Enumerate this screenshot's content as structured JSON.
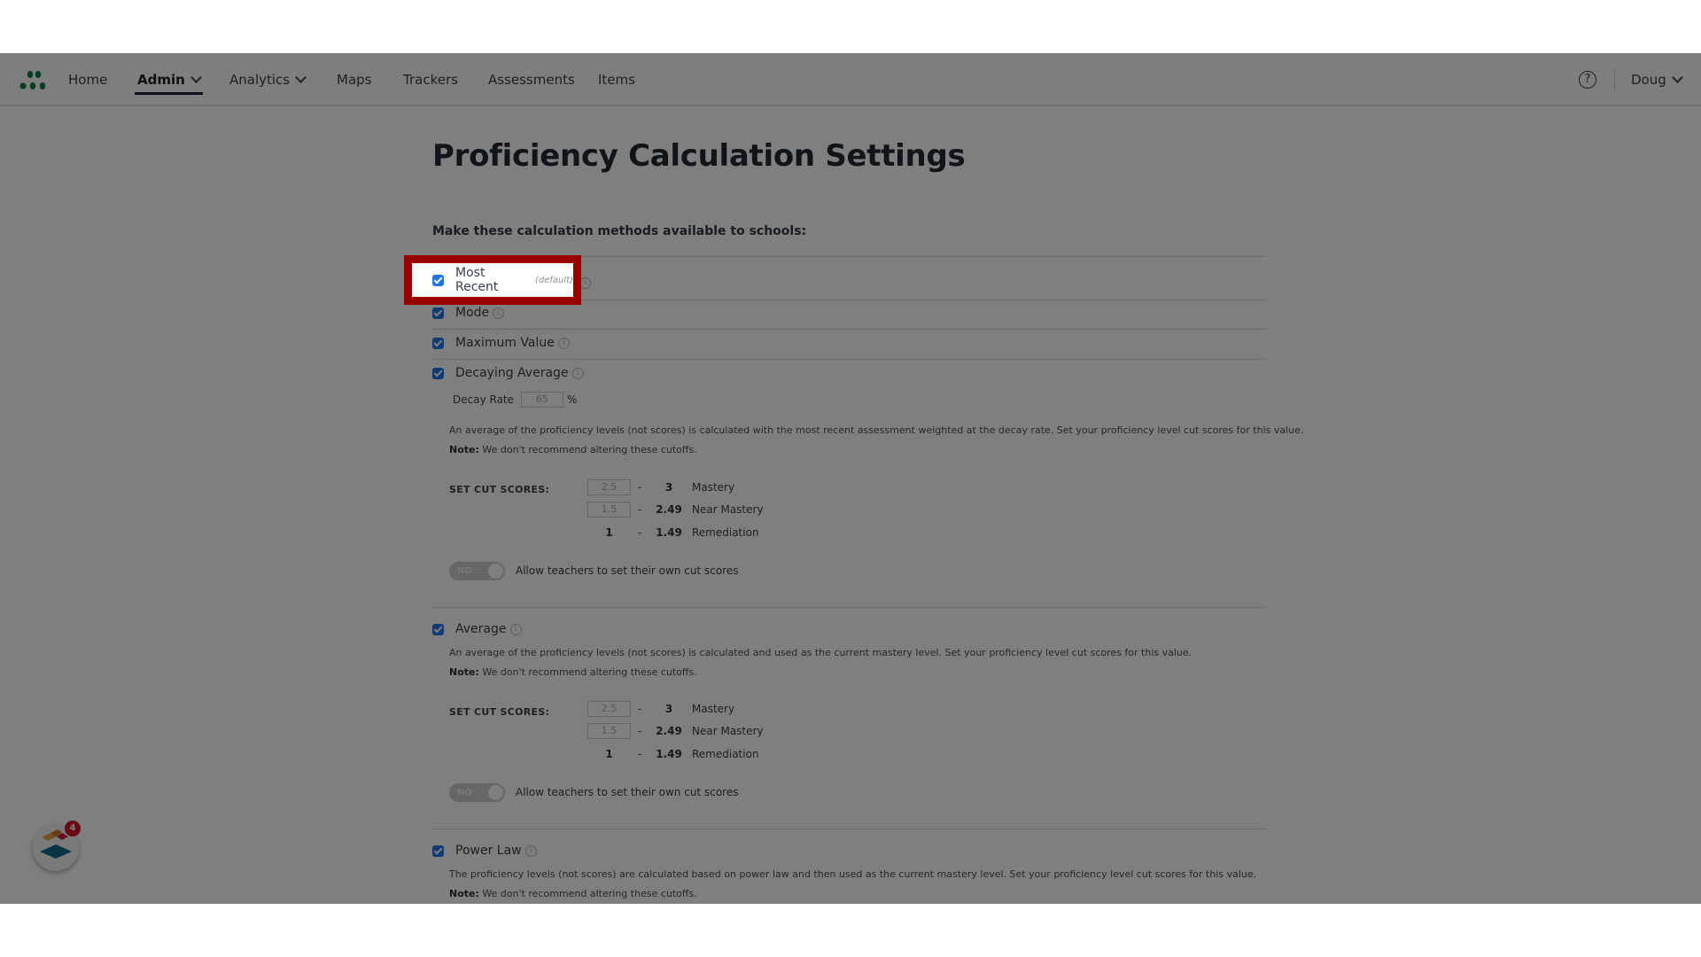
{
  "nav": {
    "logo": "app-logo",
    "items": [
      {
        "label": "Home",
        "active": false,
        "dropdown": false
      },
      {
        "label": "Admin",
        "active": true,
        "dropdown": true
      },
      {
        "label": "Analytics",
        "active": false,
        "dropdown": true
      },
      {
        "label": "Maps",
        "active": false,
        "dropdown": false
      },
      {
        "label": "Trackers",
        "active": false,
        "dropdown": false
      },
      {
        "label": "Assessments",
        "active": false,
        "dropdown": false
      },
      {
        "label": "Items",
        "active": false,
        "dropdown": false
      }
    ],
    "help_icon": "?",
    "user": "Doug"
  },
  "page": {
    "title": "Proficiency Calculation Settings",
    "subheading": "Make these calculation methods available to schools:"
  },
  "methods": [
    {
      "label": "Most Recent",
      "checked": true,
      "tag": "(default)",
      "highlighted": true
    },
    {
      "label": "Mode",
      "checked": true
    },
    {
      "label": "Maximum Value",
      "checked": true
    },
    {
      "label": "Decaying Average",
      "checked": true
    },
    {
      "label": "Average",
      "checked": true
    },
    {
      "label": "Power Law",
      "checked": true
    }
  ],
  "decaying_average": {
    "decay_rate_label": "Decay Rate",
    "decay_rate_value": "65",
    "decay_rate_unit": "%",
    "description": "An average of the proficiency levels (not scores) is calculated with the most recent assessment weighted at the decay rate. Set your proficiency level cut scores for this value.",
    "note_label": "Note:",
    "note_text": " We don't recommend altering these cutoffs.",
    "cut_scores_label": "SET CUT SCORES:",
    "cut_scores": [
      {
        "low": "2.5",
        "high": "3",
        "level": "Mastery",
        "editable": true
      },
      {
        "low": "1.5",
        "high": "2.49",
        "level": "Near Mastery",
        "editable": true
      },
      {
        "low": "1",
        "high": "1.49",
        "level": "Remediation",
        "editable": false
      }
    ],
    "toggle_state": "NO",
    "toggle_label": "Allow teachers to set their own cut scores"
  },
  "average": {
    "description": "An average of the proficiency levels (not scores) is calculated and used as the current mastery level. Set your proficiency level cut scores for this value.",
    "note_label": "Note:",
    "note_text": " We don't recommend altering these cutoffs.",
    "cut_scores_label": "SET CUT SCORES:",
    "cut_scores": [
      {
        "low": "2.5",
        "high": "3",
        "level": "Mastery",
        "editable": true
      },
      {
        "low": "1.5",
        "high": "2.49",
        "level": "Near Mastery",
        "editable": true
      },
      {
        "low": "1",
        "high": "1.49",
        "level": "Remediation",
        "editable": false
      }
    ],
    "toggle_state": "NO",
    "toggle_label": "Allow teachers to set their own cut scores"
  },
  "power_law": {
    "description": "The proficiency levels (not scores) are calculated based on power law and then used as the current mastery level. Set your proficiency level cut scores for this value.",
    "note_label": "Note:",
    "note_text": " We don't recommend altering these cutoffs."
  },
  "assistant_widget": {
    "badge_count": "4"
  },
  "colors": {
    "highlight_border": "#9b0000",
    "checkbox": "#1f74e6",
    "logo_green": "#0b6b3a",
    "badge": "#d2102c"
  }
}
